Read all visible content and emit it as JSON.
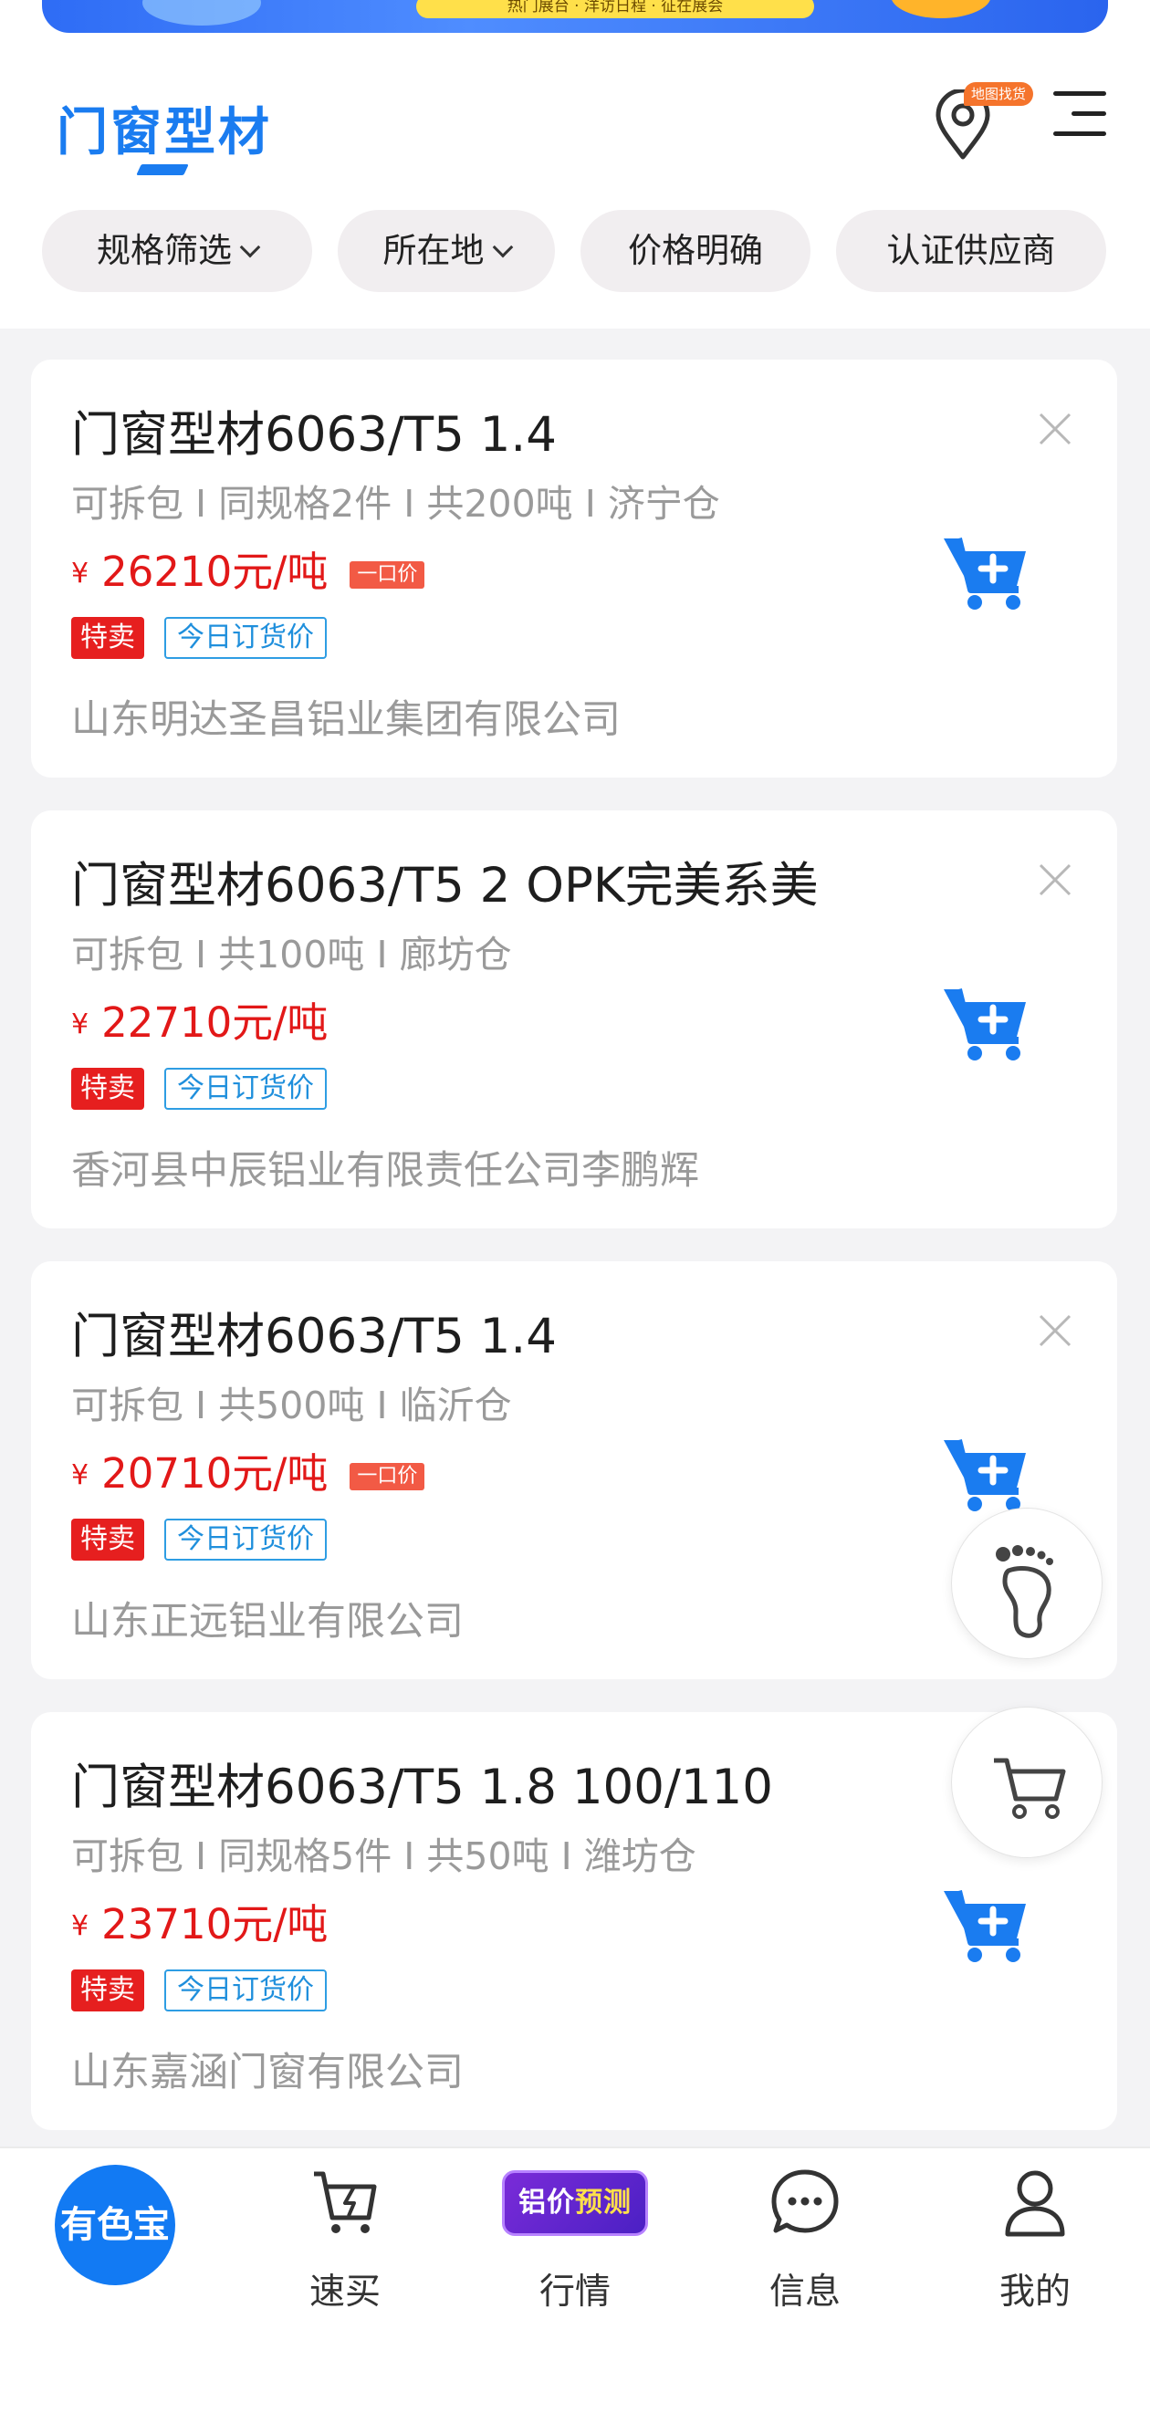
{
  "banner": {
    "text": "热门展台 · 洋访日程 · 征在展会"
  },
  "header": {
    "title": "门窗型材",
    "map_badge": "地图找货"
  },
  "filters": [
    {
      "label": "规格筛选"
    },
    {
      "label": "所在地"
    },
    {
      "label": "价格明确"
    },
    {
      "label": "认证供应商"
    }
  ],
  "products": [
    {
      "name": "门窗型材6063/T5 1.4",
      "meta": "可拆包 I 同规格2件 I 共200吨 I 济宁仓",
      "currency": "¥",
      "price": "26210元/吨",
      "fixed_price_tag": "一口价",
      "tag_special": "特卖",
      "tag_today": "今日订货价",
      "company": "山东明达圣昌铝业集团有限公司"
    },
    {
      "name": "门窗型材6063/T5 2 OPK完美系美",
      "meta": "可拆包 I 共100吨 I 廊坊仓",
      "currency": "¥",
      "price": "22710元/吨",
      "fixed_price_tag": "",
      "tag_special": "特卖",
      "tag_today": "今日订货价",
      "company": "香河县中辰铝业有限责任公司李鹏辉"
    },
    {
      "name": "门窗型材6063/T5 1.4",
      "meta": "可拆包 I 共500吨 I 临沂仓",
      "currency": "¥",
      "price": "20710元/吨",
      "fixed_price_tag": "一口价",
      "tag_special": "特卖",
      "tag_today": "今日订货价",
      "company": "山东正远铝业有限公司"
    },
    {
      "name": "门窗型材6063/T5 1.8 100/110",
      "meta": "可拆包 I 同规格5件 I 共50吨 I 潍坊仓",
      "currency": "¥",
      "price": "23710元/吨",
      "fixed_price_tag": "",
      "tag_special": "特卖",
      "tag_today": "今日订货价",
      "company": "山东嘉涵门窗有限公司"
    }
  ],
  "bottom_nav": {
    "home": "有色宝",
    "quick_buy": "速买",
    "forecast_badge_a": "铝价",
    "forecast_badge_b": "预测",
    "market": "行情",
    "messages": "信息",
    "mine": "我的"
  },
  "colors": {
    "accent": "#1a7cf0",
    "price": "#e21818",
    "tag_red": "#e61f1f",
    "tag_blue": "#1f8fdc",
    "map_badge": "#f5742c"
  }
}
